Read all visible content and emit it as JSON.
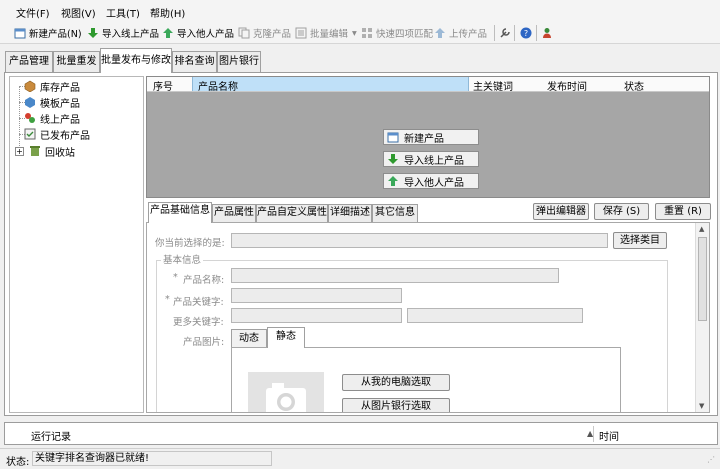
{
  "menu": [
    "文件(F)",
    "视图(V)",
    "工具(T)",
    "帮助(H)"
  ],
  "toolbar": {
    "new_product": "新建产品(N)",
    "import_online": "导入线上产品",
    "import_others": "导入他人产品",
    "clone_product": "克隆产品",
    "batch_edit": "批量编辑",
    "quick_match": "快速四项匹配",
    "upload_product": "上传产品"
  },
  "main_tabs": [
    "产品管理",
    "批量重发",
    "批量发布与修改",
    "排名查询",
    "图片银行"
  ],
  "tree": [
    "库存产品",
    "模板产品",
    "线上产品",
    "已发布产品",
    "回收站"
  ],
  "grid": {
    "columns": [
      "序号",
      "产品名称",
      "主关键词",
      "发布时间",
      "状态"
    ],
    "buttons": [
      "新建产品",
      "导入线上产品",
      "导入他人产品"
    ]
  },
  "detail_tabs": [
    "产品基础信息",
    "产品属性",
    "产品自定义属性",
    "详细描述",
    "其它信息"
  ],
  "actions": {
    "popup_editor": "弹出编辑器",
    "save": "保存 (S)",
    "reset": "重置 (R)"
  },
  "form": {
    "category_label": "你当前选择的是:",
    "select_category": "选择类目",
    "basic_info": "基本信息",
    "product_name_label": "产品名称:",
    "product_keyword_label": "产品关键字:",
    "more_keywords_label": "更多关键字:",
    "product_image_label": "产品图片:",
    "image_tabs": [
      "动态",
      "静态"
    ],
    "pick_from_pc": "从我的电脑选取",
    "pick_from_bank": "从图片银行选取"
  },
  "runlog": {
    "title": "运行记录",
    "time_col": "时间"
  },
  "status": {
    "label": "状态:",
    "message": "关键字排名查询器已就绪!"
  }
}
